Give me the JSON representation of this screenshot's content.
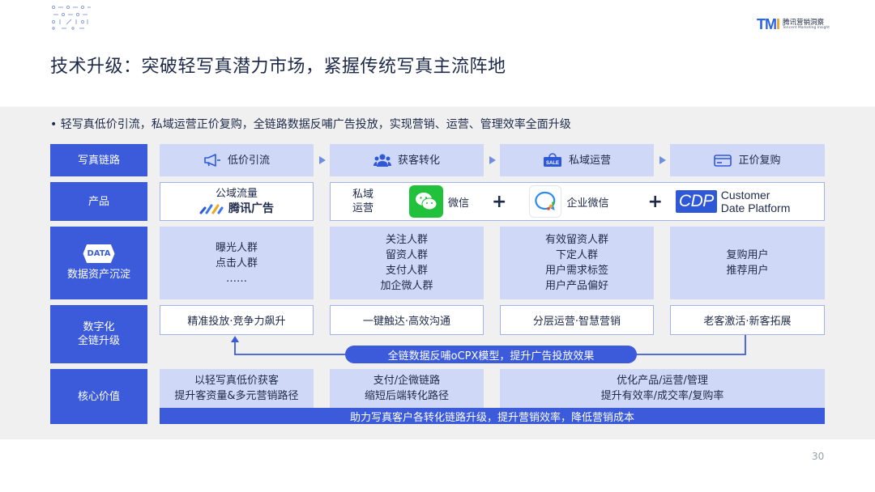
{
  "brand": {
    "mark": "TMI",
    "name_cn": "腾讯营销洞察",
    "name_en": "Tencent Marketing Insight"
  },
  "title": "技术升级：突破轻写真潜力市场，紧握传统写真主流阵地",
  "bullet": "• 轻写真低价引流，私域运营正价复购，全链路数据反哺广告投放，实现营销、运营、管理效率全面升级",
  "rows": {
    "chain": {
      "label": "写真链路",
      "steps": [
        {
          "icon": "megaphone-icon",
          "label": "低价引流"
        },
        {
          "icon": "users-icon",
          "label": "获客转化"
        },
        {
          "icon": "sale-bag-icon",
          "label": "私域运营"
        },
        {
          "icon": "card-icon",
          "label": "正价复购"
        }
      ]
    },
    "product": {
      "label": "产品",
      "public_domain": "公域流量",
      "tencent_ads": "腾讯广告",
      "private_domain_line1": "私域",
      "private_domain_line2": "运营",
      "wechat": "微信",
      "wework": "企业微信",
      "cdp_logo": "CDP",
      "cdp_line1": "Customer",
      "cdp_line2": "Date Platform",
      "plus": "+"
    },
    "data": {
      "badge": "DATA",
      "label": "数据资产沉淀",
      "cols": [
        [
          "曝光人群",
          "点击人群",
          "……"
        ],
        [
          "关注人群",
          "留资人群",
          "支付人群",
          "加企微人群"
        ],
        [
          "有效留资人群",
          "下定人群",
          "用户需求标签",
          "用户产品偏好"
        ],
        [
          "复购用户",
          "推荐用户"
        ]
      ]
    },
    "digital": {
      "label_line1": "数字化",
      "label_line2": "全链升级",
      "cells": [
        "精准投放·竞争力飙升",
        "一键触达·高效沟通",
        "分层运营·智慧营销",
        "老客激活·新客拓展"
      ],
      "feedback": "全链数据反哺oCPX模型，提升广告投放效果"
    },
    "value": {
      "label": "核心价值",
      "cols": [
        [
          "以轻写真低价获客",
          "提升客资量&多元营销路径"
        ],
        [
          "支付/企微链路",
          "缩短后端转化路径"
        ],
        [
          "优化产品/运营/管理",
          "提升有效率/成交率/复购率"
        ]
      ],
      "summary": "助力写真客户各转化链路升级，提升营销效率，降低营销成本"
    }
  },
  "page_number": "30",
  "colors": {
    "label_bg": "#3b5bdb",
    "cell_bg": "#cfd8f7",
    "band_bg": "#f0f0f0",
    "arrow": "#6f8ee0"
  }
}
